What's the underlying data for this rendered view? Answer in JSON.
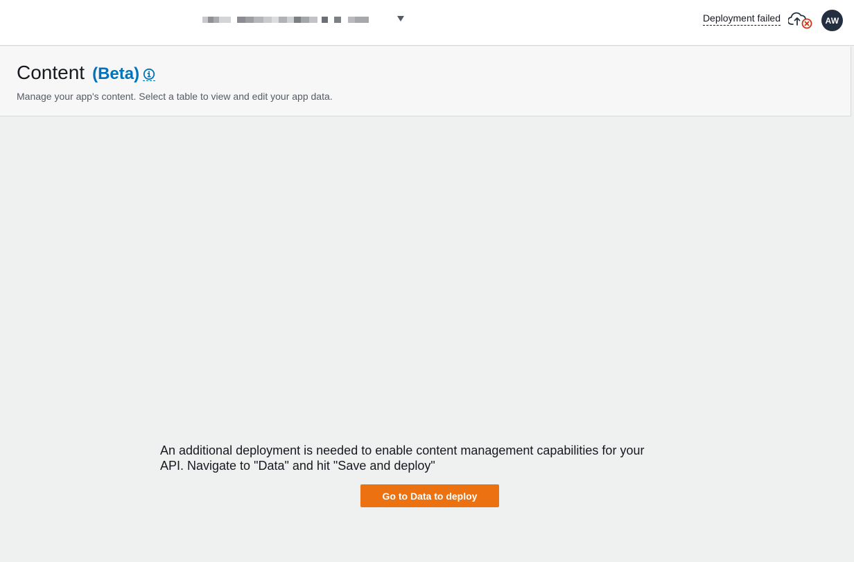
{
  "topbar": {
    "deployment_status": "Deployment failed",
    "status_icon": "cloud-upload-failed-icon",
    "user_initials": "AW",
    "app_selector_icon": "caret-down-icon"
  },
  "header": {
    "title": "Content",
    "beta_label": "(Beta)",
    "info_icon": "info-icon",
    "subtitle": "Manage your app's content. Select a table to view and edit your app data."
  },
  "main": {
    "message_line1": "An additional deployment is needed to enable content management capabilities for your",
    "message_line2": "API. Navigate to \"Data\" and hit \"Save and deploy\"",
    "button_label": "Go to Data to deploy"
  },
  "colors": {
    "accent_orange": "#ec7211",
    "link_blue": "#0073bb",
    "error_red": "#d13212",
    "avatar_bg": "#232f3e"
  }
}
